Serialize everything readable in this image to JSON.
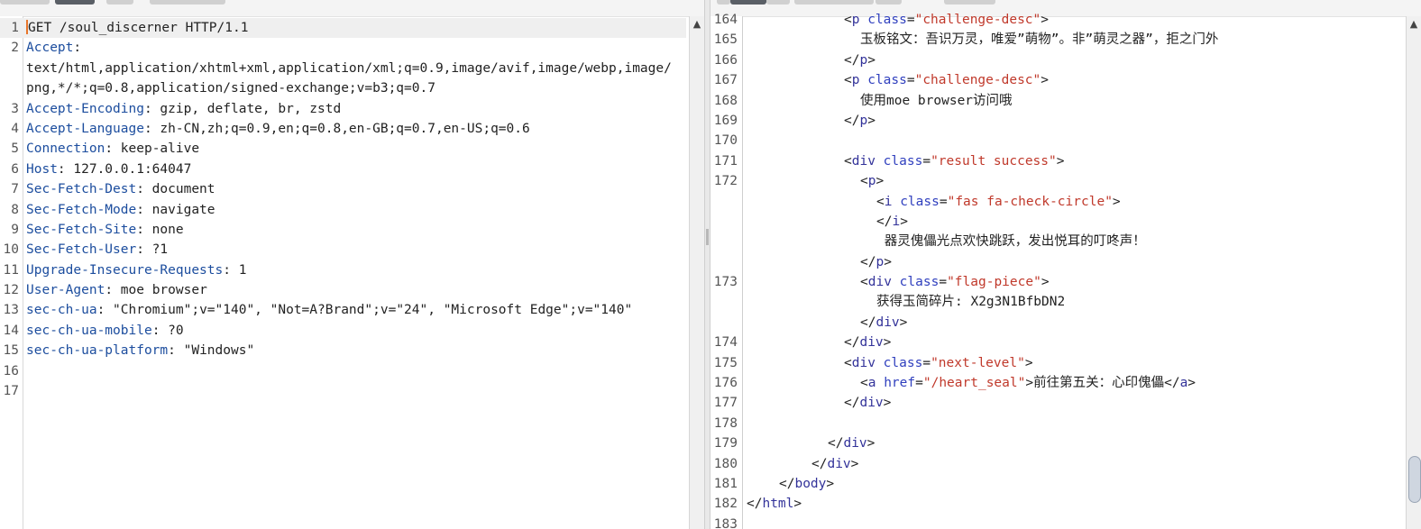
{
  "request_editor": {
    "lines": [
      {
        "n": "1",
        "k": "",
        "v": "GET /soul_discerner HTTP/1.1",
        "caret": true
      },
      {
        "n": "2",
        "k": "Accept",
        "v": ""
      },
      {
        "n": "",
        "k": "",
        "v": "text/html,application/xhtml+xml,application/xml;q=0.9,image/avif,image/webp,image/"
      },
      {
        "n": "",
        "k": "",
        "v": "png,*/*;q=0.8,application/signed-exchange;v=b3;q=0.7"
      },
      {
        "n": "3",
        "k": "Accept-Encoding",
        "v": " gzip, deflate, br, zstd"
      },
      {
        "n": "4",
        "k": "Accept-Language",
        "v": " zh-CN,zh;q=0.9,en;q=0.8,en-GB;q=0.7,en-US;q=0.6"
      },
      {
        "n": "5",
        "k": "Connection",
        "v": " keep-alive"
      },
      {
        "n": "6",
        "k": "Host",
        "v": " 127.0.0.1:64047"
      },
      {
        "n": "7",
        "k": "Sec-Fetch-Dest",
        "v": " document"
      },
      {
        "n": "8",
        "k": "Sec-Fetch-Mode",
        "v": " navigate"
      },
      {
        "n": "9",
        "k": "Sec-Fetch-Site",
        "v": " none"
      },
      {
        "n": "10",
        "k": "Sec-Fetch-User",
        "v": " ?1"
      },
      {
        "n": "11",
        "k": "Upgrade-Insecure-Requests",
        "v": " 1"
      },
      {
        "n": "12",
        "k": "User-Agent",
        "v": " moe browser"
      },
      {
        "n": "13",
        "k": "sec-ch-ua",
        "v": " \"Chromium\";v=\"140\", \"Not=A?Brand\";v=\"24\", \"Microsoft Edge\";v=\"140\""
      },
      {
        "n": "14",
        "k": "sec-ch-ua-mobile",
        "v": " ?0"
      },
      {
        "n": "15",
        "k": "sec-ch-ua-platform",
        "v": " \"Windows\""
      },
      {
        "n": "16",
        "k": "",
        "v": ""
      },
      {
        "n": "17",
        "k": "",
        "v": ""
      }
    ]
  },
  "response_viewer": {
    "lines": [
      {
        "n": "164",
        "ind": 6,
        "seg": [
          [
            "t",
            "<"
          ],
          [
            "g",
            "p"
          ],
          [
            "a",
            " class"
          ],
          [
            "t",
            "="
          ],
          [
            "v",
            "\"challenge-desc\""
          ],
          [
            "t",
            ">"
          ]
        ]
      },
      {
        "n": "165",
        "ind": 7,
        "seg": [
          [
            "t",
            "玉板铭文：吾识万灵，唯爱”萌物”。非”萌灵之器”，拒之门外"
          ]
        ]
      },
      {
        "n": "166",
        "ind": 6,
        "seg": [
          [
            "t",
            "</"
          ],
          [
            "g",
            "p"
          ],
          [
            "t",
            ">"
          ]
        ]
      },
      {
        "n": "167",
        "ind": 6,
        "seg": [
          [
            "t",
            "<"
          ],
          [
            "g",
            "p"
          ],
          [
            "a",
            " class"
          ],
          [
            "t",
            "="
          ],
          [
            "v",
            "\"challenge-desc\""
          ],
          [
            "t",
            ">"
          ]
        ]
      },
      {
        "n": "168",
        "ind": 7,
        "seg": [
          [
            "t",
            "使用moe browser访问哦"
          ]
        ]
      },
      {
        "n": "169",
        "ind": 6,
        "seg": [
          [
            "t",
            "</"
          ],
          [
            "g",
            "p"
          ],
          [
            "t",
            ">"
          ]
        ]
      },
      {
        "n": "170",
        "ind": 0,
        "seg": []
      },
      {
        "n": "171",
        "ind": 6,
        "seg": [
          [
            "t",
            "<"
          ],
          [
            "g",
            "div"
          ],
          [
            "a",
            " class"
          ],
          [
            "t",
            "="
          ],
          [
            "v",
            "\"result success\""
          ],
          [
            "t",
            ">"
          ]
        ]
      },
      {
        "n": "172",
        "ind": 7,
        "seg": [
          [
            "t",
            "<"
          ],
          [
            "g",
            "p"
          ],
          [
            "t",
            ">"
          ]
        ]
      },
      {
        "n": "",
        "ind": 8,
        "seg": [
          [
            "t",
            "<"
          ],
          [
            "g",
            "i"
          ],
          [
            "a",
            " class"
          ],
          [
            "t",
            "="
          ],
          [
            "v",
            "\"fas fa-check-circle\""
          ],
          [
            "t",
            ">"
          ]
        ]
      },
      {
        "n": "",
        "ind": 8,
        "seg": [
          [
            "t",
            "</"
          ],
          [
            "g",
            "i"
          ],
          [
            "t",
            ">"
          ]
        ]
      },
      {
        "n": "",
        "ind": 8,
        "seg": [
          [
            "t",
            " 器灵傀儡光点欢快跳跃，发出悦耳的叮咚声！"
          ]
        ]
      },
      {
        "n": "",
        "ind": 7,
        "seg": [
          [
            "t",
            "</"
          ],
          [
            "g",
            "p"
          ],
          [
            "t",
            ">"
          ]
        ]
      },
      {
        "n": "173",
        "ind": 7,
        "seg": [
          [
            "t",
            "<"
          ],
          [
            "g",
            "div"
          ],
          [
            "a",
            " class"
          ],
          [
            "t",
            "="
          ],
          [
            "v",
            "\"flag-piece\""
          ],
          [
            "t",
            ">"
          ]
        ]
      },
      {
        "n": "",
        "ind": 8,
        "seg": [
          [
            "t",
            "获得玉简碎片: X2g3N1BfbDN2"
          ]
        ]
      },
      {
        "n": "",
        "ind": 7,
        "seg": [
          [
            "t",
            "</"
          ],
          [
            "g",
            "div"
          ],
          [
            "t",
            ">"
          ]
        ]
      },
      {
        "n": "174",
        "ind": 6,
        "seg": [
          [
            "t",
            "</"
          ],
          [
            "g",
            "div"
          ],
          [
            "t",
            ">"
          ]
        ]
      },
      {
        "n": "175",
        "ind": 6,
        "seg": [
          [
            "t",
            "<"
          ],
          [
            "g",
            "div"
          ],
          [
            "a",
            " class"
          ],
          [
            "t",
            "="
          ],
          [
            "v",
            "\"next-level\""
          ],
          [
            "t",
            ">"
          ]
        ]
      },
      {
        "n": "176",
        "ind": 7,
        "seg": [
          [
            "t",
            "<"
          ],
          [
            "g",
            "a"
          ],
          [
            "a",
            " href"
          ],
          [
            "t",
            "="
          ],
          [
            "v",
            "\"/heart_seal\""
          ],
          [
            "t",
            ">前往第五关：心印傀儡</"
          ],
          [
            "g",
            "a"
          ],
          [
            "t",
            ">"
          ]
        ]
      },
      {
        "n": "177",
        "ind": 6,
        "seg": [
          [
            "t",
            "</"
          ],
          [
            "g",
            "div"
          ],
          [
            "t",
            ">"
          ]
        ]
      },
      {
        "n": "178",
        "ind": 0,
        "seg": []
      },
      {
        "n": "179",
        "ind": 5,
        "seg": [
          [
            "t",
            "</"
          ],
          [
            "g",
            "div"
          ],
          [
            "t",
            ">"
          ]
        ]
      },
      {
        "n": "180",
        "ind": 4,
        "seg": [
          [
            "t",
            "</"
          ],
          [
            "g",
            "div"
          ],
          [
            "t",
            ">"
          ]
        ]
      },
      {
        "n": "181",
        "ind": 2,
        "seg": [
          [
            "t",
            "</"
          ],
          [
            "g",
            "body"
          ],
          [
            "t",
            ">"
          ]
        ]
      },
      {
        "n": "182",
        "ind": 0,
        "seg": [
          [
            "t",
            "</"
          ],
          [
            "g",
            "html"
          ],
          [
            "t",
            ">"
          ]
        ]
      },
      {
        "n": "183",
        "ind": 0,
        "seg": []
      }
    ]
  },
  "icons": {
    "scroll_up": "scroll-up-arrow-icon",
    "divider_grip": "divider-grip-icon"
  },
  "colors": {
    "header_key": "#1c4d9e",
    "tag_name": "#33339a",
    "attr_name": "#2f3fbe",
    "attr_value": "#c0392b",
    "caret": "#e8762b"
  }
}
